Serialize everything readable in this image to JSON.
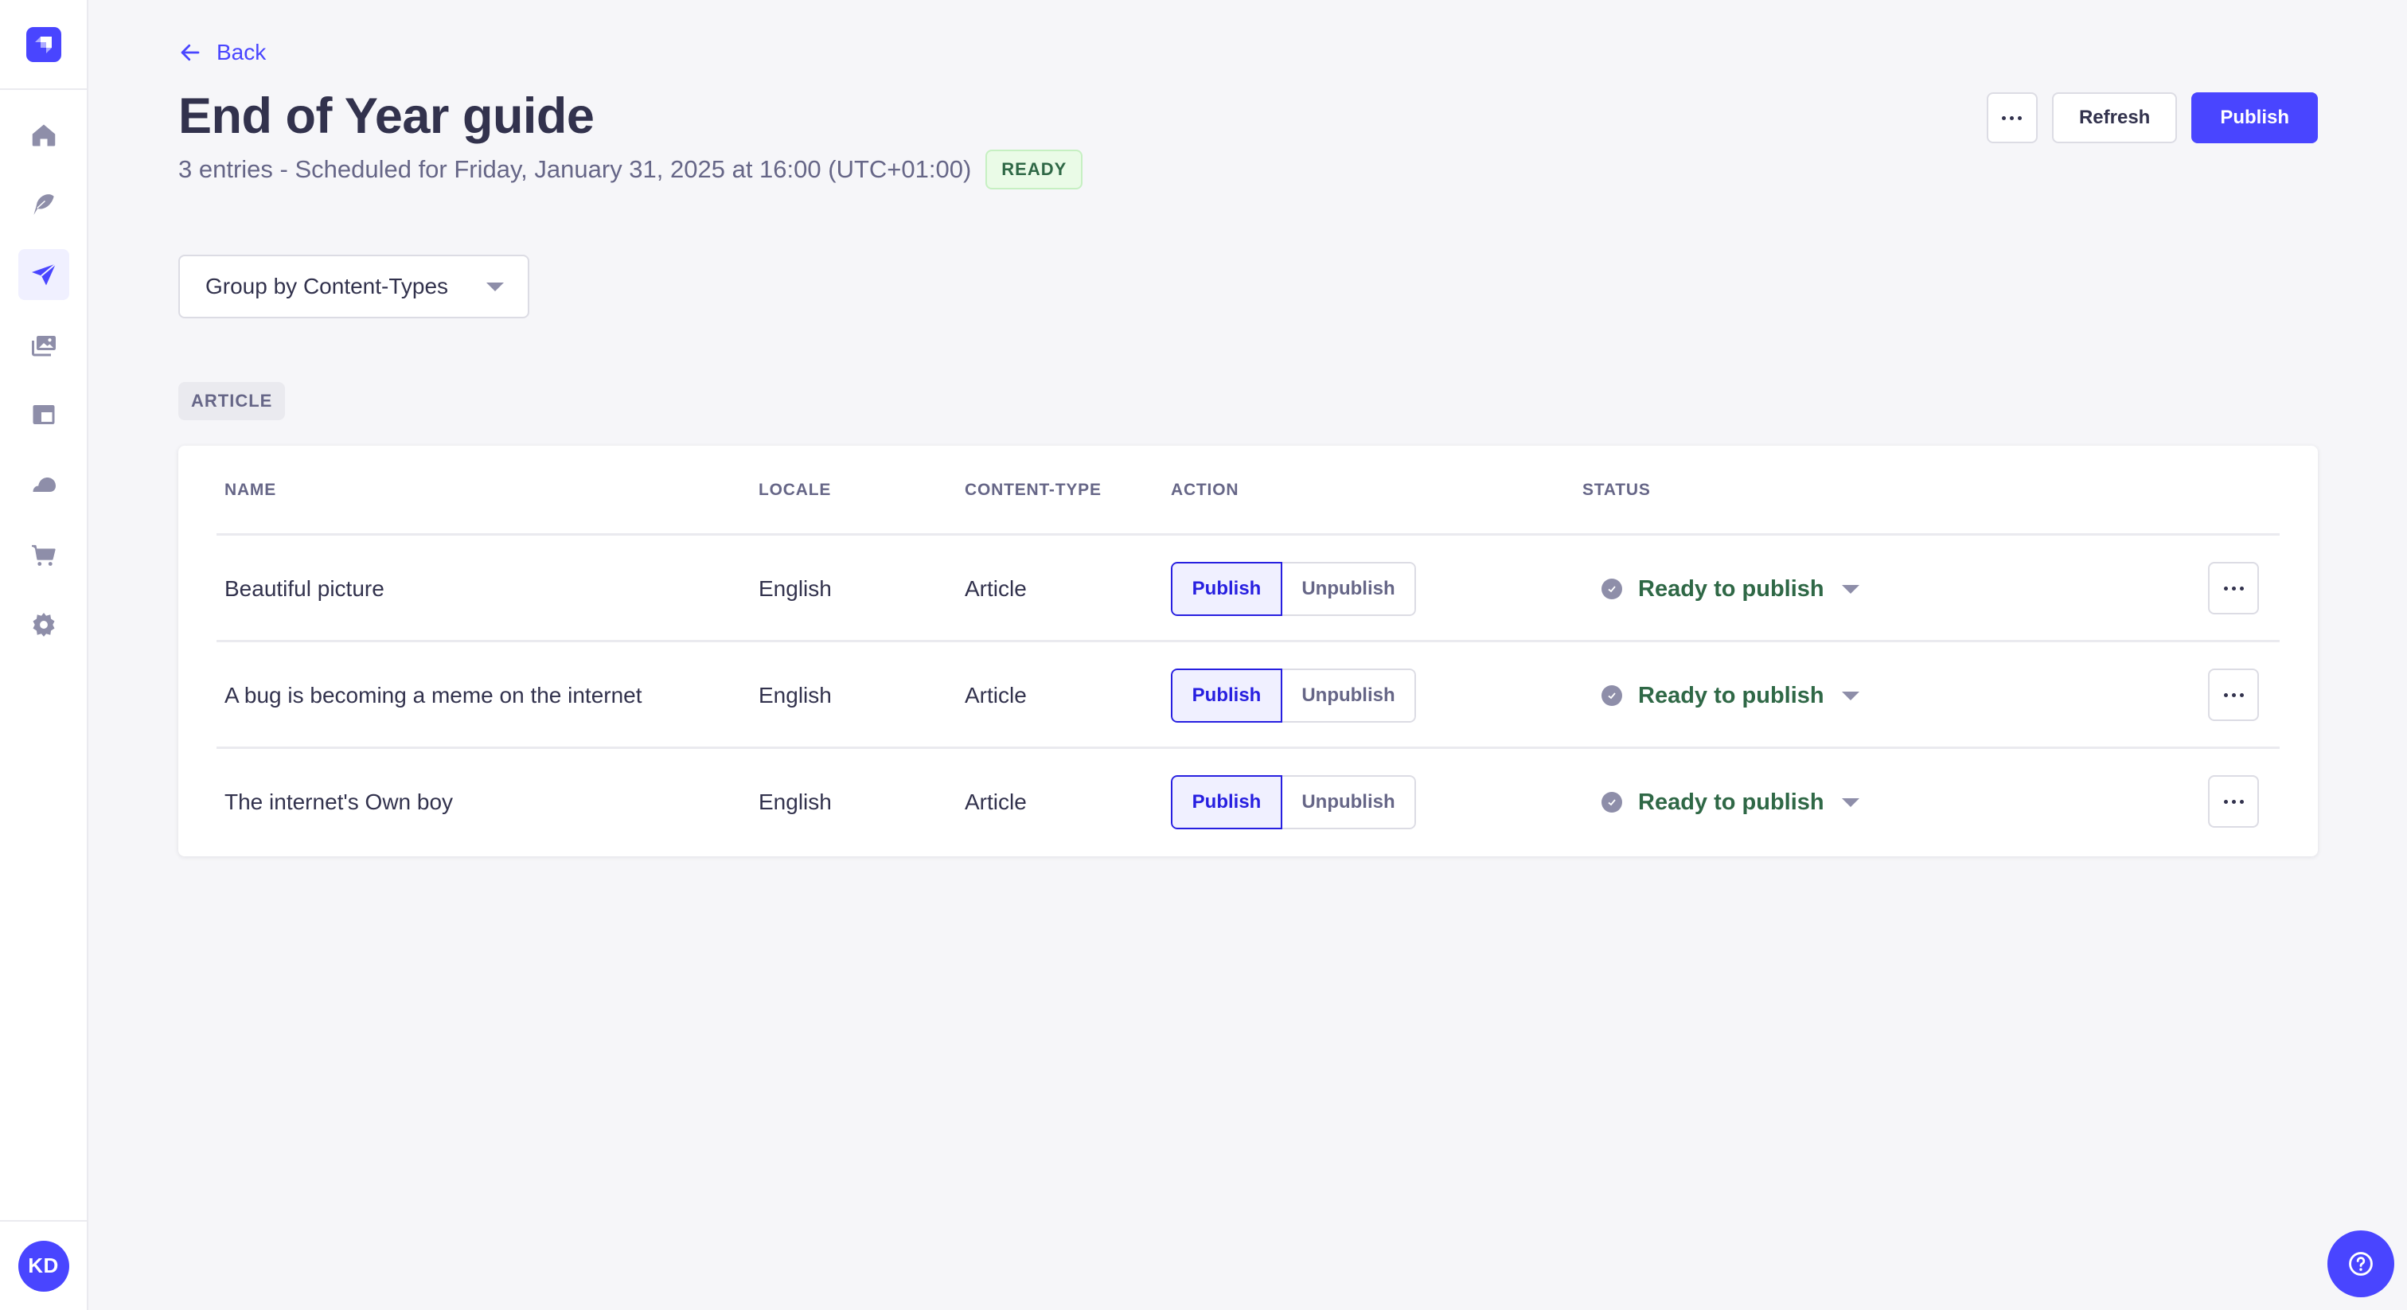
{
  "sidebar": {
    "logo": "strapi-logo-icon",
    "items": [
      {
        "icon": "home-icon",
        "label": "Home",
        "active": false
      },
      {
        "icon": "feather-icon",
        "label": "Content Manager",
        "active": false
      },
      {
        "icon": "paper-plane-icon",
        "label": "Releases",
        "active": true
      },
      {
        "icon": "images-icon",
        "label": "Media Library",
        "active": false
      },
      {
        "icon": "layout-icon",
        "label": "Content-Type Builder",
        "active": false
      },
      {
        "icon": "cloud-icon",
        "label": "Deploy",
        "active": false
      },
      {
        "icon": "cart-icon",
        "label": "Marketplace",
        "active": false
      },
      {
        "icon": "gear-icon",
        "label": "Settings",
        "active": false
      }
    ],
    "user_initials": "KD"
  },
  "header": {
    "back_label": "Back",
    "title": "End of Year guide",
    "subtitle": "3 entries - Scheduled for Friday, January 31, 2025 at 16:00 (UTC+01:00)",
    "status_badge": "READY",
    "actions": {
      "more_label": "More actions",
      "refresh_label": "Refresh",
      "publish_label": "Publish"
    }
  },
  "groupby": {
    "selected": "Group by Content-Types"
  },
  "group": {
    "label": "ARTICLE"
  },
  "table": {
    "columns": [
      "NAME",
      "LOCALE",
      "CONTENT-TYPE",
      "ACTION",
      "STATUS"
    ],
    "rows": [
      {
        "name": "Beautiful picture",
        "locale": "English",
        "content_type": "Article",
        "action_on": "Publish",
        "action_off": "Unpublish",
        "status": "Ready to publish"
      },
      {
        "name": "A bug is becoming a meme on the internet",
        "locale": "English",
        "content_type": "Article",
        "action_on": "Publish",
        "action_off": "Unpublish",
        "status": "Ready to publish"
      },
      {
        "name": "The internet's Own boy",
        "locale": "English",
        "content_type": "Article",
        "action_on": "Publish",
        "action_off": "Unpublish",
        "status": "Ready to publish"
      }
    ]
  },
  "colors": {
    "primary": "#4945ff",
    "primary_dark": "#271fe0",
    "success_text": "#2f6846",
    "neutral_text": "#32324d",
    "muted_text": "#666687",
    "background": "#f6f6f9"
  },
  "help_icon": "question-circle-icon"
}
